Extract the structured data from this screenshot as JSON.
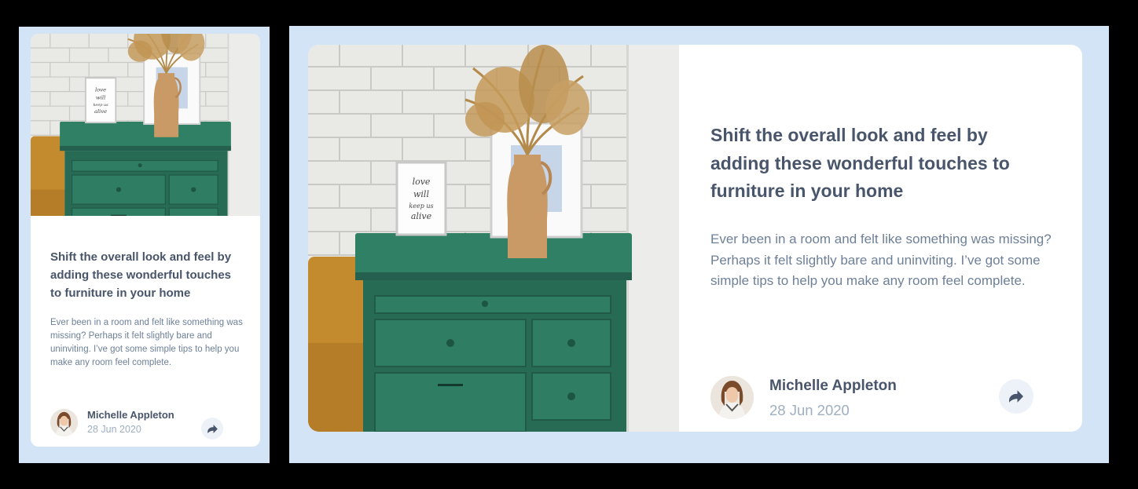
{
  "article": {
    "headline": "Shift the overall look and feel by adding these wonderful touches to furniture in your home",
    "description": "Ever been in a room and felt like something was missing? Perhaps it felt slightly bare and uninviting. I’ve got some simple tips to help you make any room feel complete.",
    "author": "Michelle Appleton",
    "date": "28 Jun 2020",
    "frame_lettering": "love will keep us alive"
  },
  "colors": {
    "background": "#d3e4f6",
    "card": "#ffffff",
    "headline": "#48556a",
    "body_text": "#6e8098",
    "date_text": "#9eafc2",
    "share_button": "#ecf2f8",
    "drawer_green": "#2e7a62"
  },
  "icons": {
    "share": "share-arrow-icon",
    "avatar": "avatar"
  }
}
